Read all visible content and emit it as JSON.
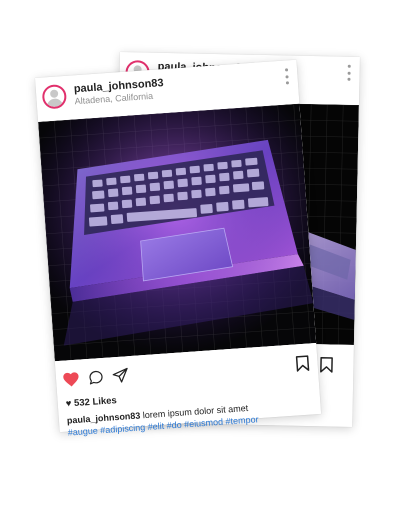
{
  "back_post": {
    "username": "paula_johnson83",
    "caption_partial": "t",
    "tags_partial": "mpor"
  },
  "front_post": {
    "username": "paula_johnson83",
    "location": "Altadena, California",
    "likes": "532 Likes",
    "caption": "lorem ipsum dolor sit amet",
    "tags": "#augue  #adipiscing #elit #do #eiusmod #tempor",
    "liked": true
  },
  "colors": {
    "like_red": "#ed4956",
    "hashtag_blue": "#2a78d4",
    "avatar_ring": "#e1306c"
  },
  "icons": [
    "more-options-icon",
    "heart-icon",
    "comment-icon",
    "share-icon",
    "bookmark-icon"
  ]
}
